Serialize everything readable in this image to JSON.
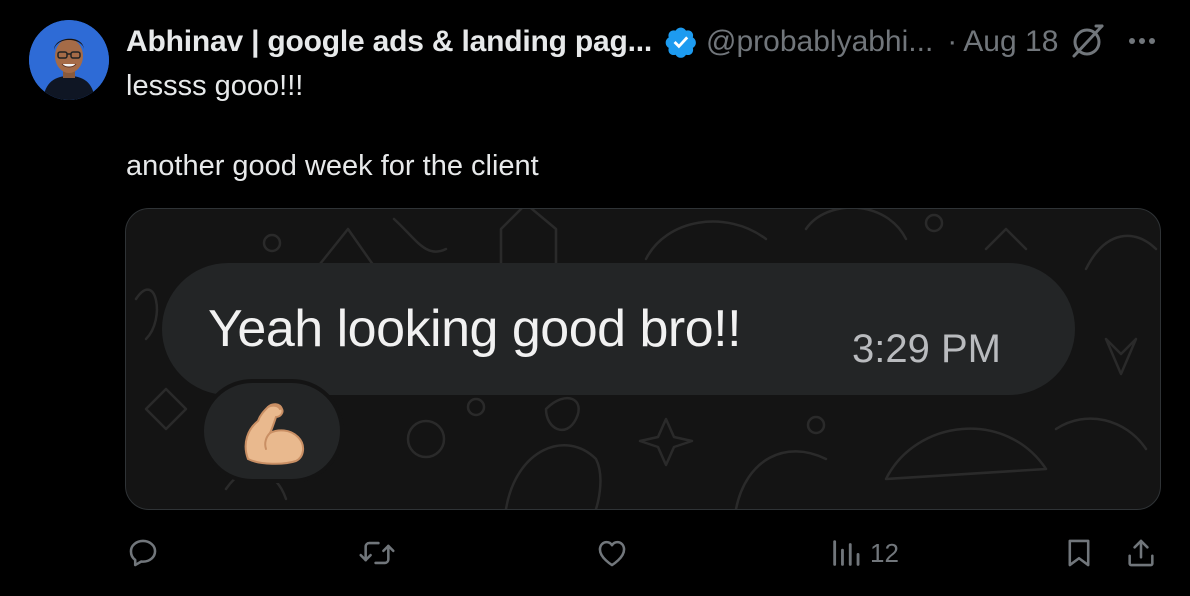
{
  "colors": {
    "background": "#000000",
    "text_primary": "#e7e9ea",
    "text_secondary": "#71767b",
    "verified_badge": "#1d9bf0",
    "media_border": "#2f3336",
    "chat_bubble": "#232526"
  },
  "tweet": {
    "author_name": "Abhinav | google ads & landing pag...",
    "author_handle": "@probablyabhi...",
    "separator": "·",
    "date": "Aug 18",
    "verified": true,
    "text_lines": [
      "lessss gooo!!!",
      "another good week for the client"
    ]
  },
  "media": {
    "message_text": "Yeah looking good bro!!",
    "message_time": "3:29 PM",
    "reaction_emoji": "💪",
    "reaction_icon": "flexed-biceps-icon"
  },
  "actions": {
    "reply": {
      "icon": "reply-icon",
      "count": ""
    },
    "retweet": {
      "icon": "retweet-icon",
      "count": ""
    },
    "like": {
      "icon": "heart-icon",
      "count": ""
    },
    "views": {
      "icon": "views-icon",
      "count": "12"
    },
    "bookmark": {
      "icon": "bookmark-icon"
    },
    "share": {
      "icon": "share-icon"
    }
  },
  "header_icons": {
    "grok": "grok-icon",
    "more": "more-icon"
  }
}
